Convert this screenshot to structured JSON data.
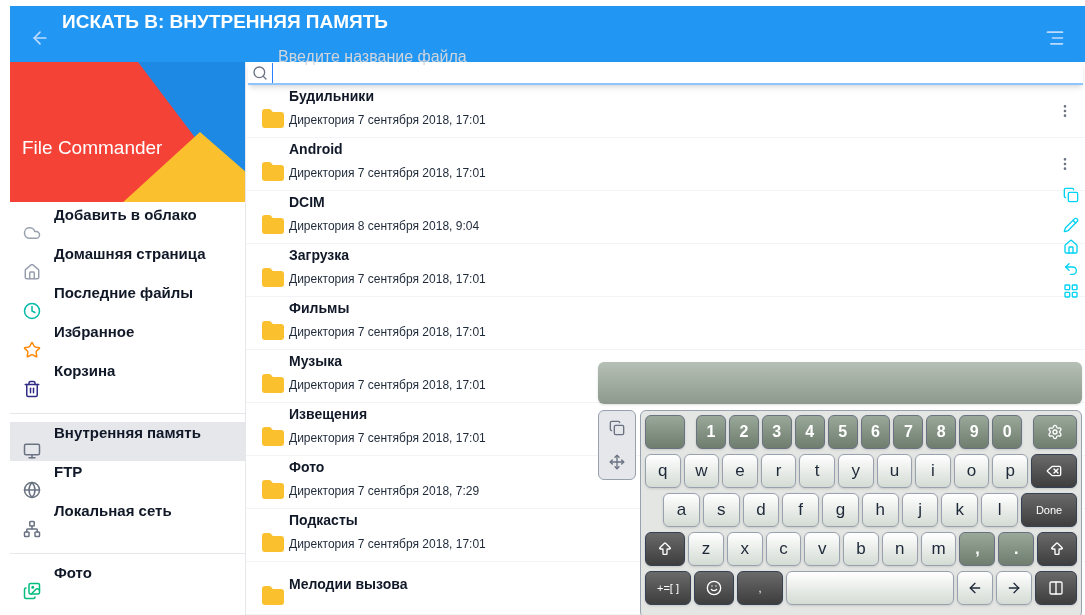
{
  "header": {
    "title": "ИСКАТЬ В: ВНУТРЕННЯЯ ПАМЯТЬ",
    "search_placeholder": "Введите название файла"
  },
  "sidebar": {
    "app_name": "File Commander",
    "groups": [
      [
        {
          "label": "Добавить в облако",
          "selected": false
        },
        {
          "label": "Домашняя страница",
          "selected": false
        },
        {
          "label": "Последние файлы",
          "selected": false
        },
        {
          "label": "Избранное",
          "selected": false
        },
        {
          "label": "Корзина",
          "selected": false
        }
      ],
      [
        {
          "label": "Внутренняя память",
          "selected": true
        },
        {
          "label": "FTP",
          "selected": false
        },
        {
          "label": "Локальная сеть",
          "selected": false
        }
      ],
      [
        {
          "label": "Фото",
          "selected": false
        }
      ]
    ]
  },
  "files": [
    {
      "name": "Будильники",
      "details": "Директория 7 сентября 2018, 17:01",
      "has_menu": true
    },
    {
      "name": "Android",
      "details": "Директория 7 сентября 2018, 17:01",
      "has_menu": true
    },
    {
      "name": "DCIM",
      "details": "Директория 8 сентября 2018, 9:04",
      "has_menu": false
    },
    {
      "name": "Загрузка",
      "details": "Директория 7 сентября 2018, 17:01",
      "has_menu": false
    },
    {
      "name": "Фильмы",
      "details": "Директория 7 сентября 2018, 17:01",
      "has_menu": false
    },
    {
      "name": "Музыка",
      "details": "Директория 7 сентября 2018, 17:01"
    },
    {
      "name": "Извещения",
      "details": "Директория 7 сентября 2018, 17:01"
    },
    {
      "name": "Фото",
      "details": "Директория 7 сентября 2018, 7:29"
    },
    {
      "name": "Подкасты",
      "details": "Директория 7 сентября 2018, 17:01"
    },
    {
      "name": "Мелодии вызова"
    }
  ],
  "keyboard": {
    "top_row": [
      {
        "kind": "tiny"
      },
      {
        "kind": "num",
        "label": "1"
      },
      {
        "kind": "num",
        "label": "2"
      },
      {
        "kind": "num",
        "label": "3"
      },
      {
        "kind": "num",
        "label": "4"
      },
      {
        "kind": "num",
        "label": "5"
      },
      {
        "kind": "num",
        "label": "6"
      },
      {
        "kind": "num",
        "label": "7"
      },
      {
        "kind": "num",
        "label": "8"
      },
      {
        "kind": "num",
        "label": "9"
      },
      {
        "kind": "num",
        "label": "0"
      },
      {
        "kind": "settings"
      }
    ],
    "rows": [
      [
        {
          "kind": "char",
          "label": "q"
        },
        {
          "kind": "char",
          "label": "w"
        },
        {
          "kind": "char",
          "label": "e"
        },
        {
          "kind": "char",
          "label": "r"
        },
        {
          "kind": "char",
          "label": "t"
        },
        {
          "kind": "char",
          "label": "y"
        },
        {
          "kind": "char",
          "label": "u"
        },
        {
          "kind": "char",
          "label": "i"
        },
        {
          "kind": "char",
          "label": "o"
        },
        {
          "kind": "char",
          "label": "p"
        },
        {
          "kind": "backspace"
        }
      ],
      [
        {
          "kind": "char",
          "label": "a"
        },
        {
          "kind": "char",
          "label": "s"
        },
        {
          "kind": "char",
          "label": "d"
        },
        {
          "kind": "char",
          "label": "f"
        },
        {
          "kind": "char",
          "label": "g"
        },
        {
          "kind": "char",
          "label": "h"
        },
        {
          "kind": "char",
          "label": "j"
        },
        {
          "kind": "char",
          "label": "k"
        },
        {
          "kind": "char",
          "label": "l"
        },
        {
          "kind": "dark",
          "label": "Done"
        }
      ],
      [
        {
          "kind": "shift"
        },
        {
          "kind": "char",
          "label": "z"
        },
        {
          "kind": "char",
          "label": "x"
        },
        {
          "kind": "char",
          "label": "c"
        },
        {
          "kind": "char",
          "label": "v"
        },
        {
          "kind": "char",
          "label": "b"
        },
        {
          "kind": "char",
          "label": "n"
        },
        {
          "kind": "char",
          "label": "m"
        },
        {
          "kind": "num",
          "label": ","
        },
        {
          "kind": "num",
          "label": "."
        },
        {
          "kind": "shift"
        }
      ],
      [
        {
          "kind": "dark",
          "label": "+=[ ]"
        },
        {
          "kind": "emoji"
        },
        {
          "kind": "dark",
          "label": ","
        },
        {
          "kind": "space"
        },
        {
          "kind": "left"
        },
        {
          "kind": "right"
        },
        {
          "kind": "split"
        }
      ]
    ]
  }
}
